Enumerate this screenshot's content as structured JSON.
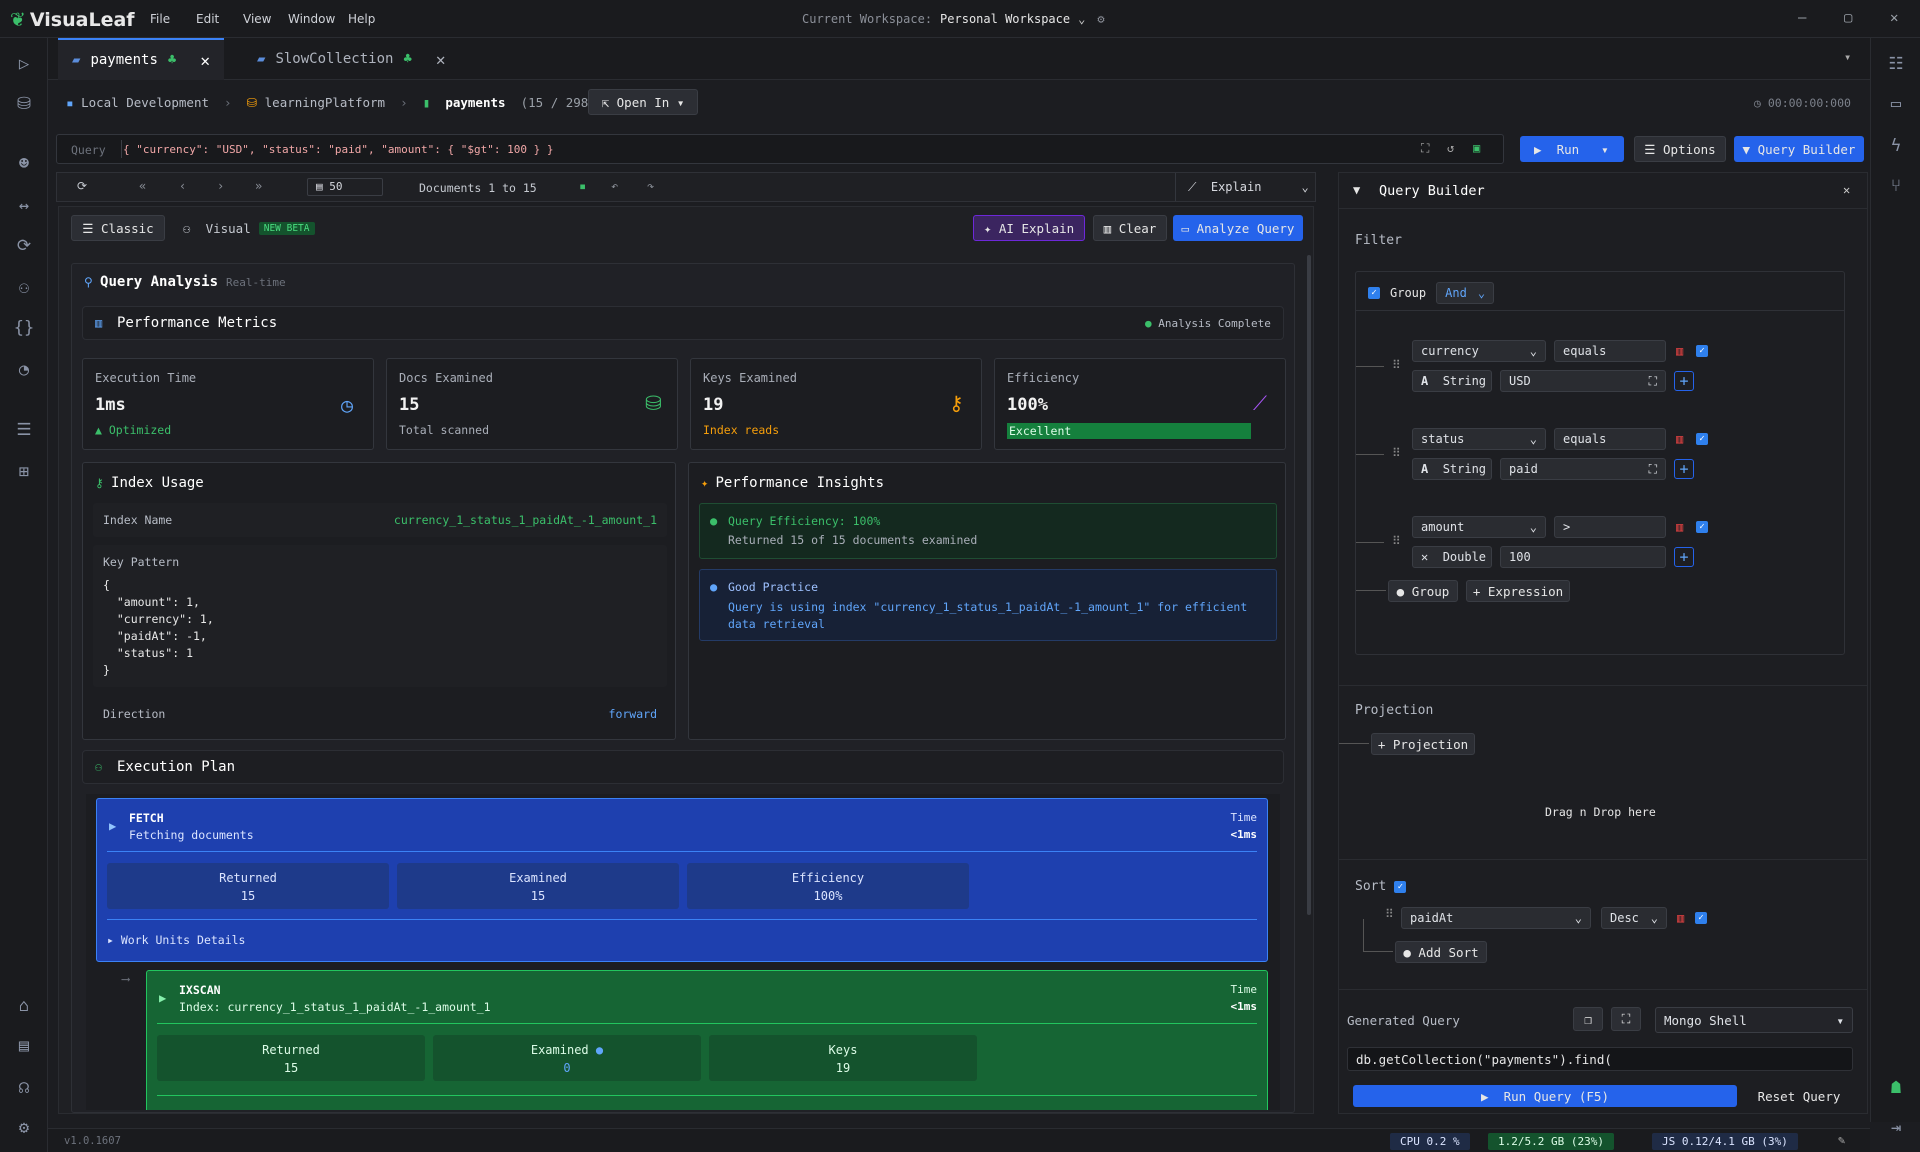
{
  "app": {
    "name": "VisuaLeaf",
    "version": "v1.0.1607"
  },
  "menu": [
    "File",
    "Edit",
    "View",
    "Window",
    "Help"
  ],
  "workspace": {
    "label": "Current Workspace:",
    "value": "Personal Workspace"
  },
  "tabs": [
    {
      "label": "payments",
      "active": true
    },
    {
      "label": "SlowCollection",
      "active": false
    }
  ],
  "breadcrumb": {
    "connection": "Local Development",
    "database": "learningPlatform",
    "collection": "payments",
    "count": "(15 / 298)",
    "open_in": "Open In",
    "timer": "00:00:00:000"
  },
  "query": {
    "label": "Query",
    "value": "{ \"currency\": \"USD\", \"status\": \"paid\", \"amount\": { \"$gt\": 100 } }",
    "run": "Run",
    "options": "Options",
    "query_builder": "Query Builder"
  },
  "toolbar": {
    "page_size": "50",
    "docs_range": "Documents 1 to 15",
    "explain": "Explain"
  },
  "analysis": {
    "classic": "Classic",
    "visual": "Visual",
    "new_beta": "NEW BETA",
    "ai_explain": "AI Explain",
    "clear": "Clear",
    "analyze": "Analyze Query",
    "title": "Query Analysis",
    "subtitle": "Real-time",
    "perf_title": "Performance Metrics",
    "complete": "Analysis Complete",
    "metrics": [
      {
        "label": "Execution Time",
        "value": "1ms",
        "sub": "▲ Optimized"
      },
      {
        "label": "Docs Examined",
        "value": "15",
        "sub": "Total scanned"
      },
      {
        "label": "Keys Examined",
        "value": "19",
        "sub": "Index reads"
      },
      {
        "label": "Efficiency",
        "value": "100%",
        "sub": "Excellent",
        "bar": 1.0
      }
    ],
    "index": {
      "title": "Index Usage",
      "name_label": "Index Name",
      "name_value": "currency_1_status_1_paidAt_-1_amount_1",
      "pattern_label": "Key Pattern",
      "pattern_lines": [
        "{",
        "  \"amount\": 1,",
        "  \"currency\": 1,",
        "  \"paidAt\": -1,",
        "  \"status\": 1",
        "}"
      ],
      "direction_label": "Direction",
      "direction_value": "forward"
    },
    "insights": {
      "title": "Performance Insights",
      "items": [
        {
          "title": "Query Efficiency: 100%",
          "text": "Returned 15 of 15 documents examined"
        },
        {
          "title": "Good Practice",
          "text": "Query is using index \"currency_1_status_1_paidAt_-1_amount_1\" for efficient data retrieval"
        }
      ]
    },
    "plan": {
      "title": "Execution Plan",
      "fetch": {
        "name": "FETCH",
        "desc": "Fetching documents",
        "time_label": "Time",
        "time": "<1ms",
        "stats": [
          {
            "label": "Returned",
            "value": "15"
          },
          {
            "label": "Examined",
            "value": "15"
          },
          {
            "label": "Efficiency",
            "value": "100%"
          }
        ],
        "work_units": "Work Units Details"
      },
      "ixscan": {
        "name": "IXSCAN",
        "desc": "Index: currency_1_status_1_paidAt_-1_amount_1",
        "time_label": "Time",
        "time": "<1ms",
        "stats": [
          {
            "label": "Returned",
            "value": "15"
          },
          {
            "label": "Examined",
            "value": "0"
          },
          {
            "label": "Keys",
            "value": "19"
          }
        ]
      }
    }
  },
  "builder": {
    "title": "Query Builder",
    "filter": "Filter",
    "group": "Group",
    "logic": "And",
    "conditions": [
      {
        "field": "currency",
        "op": "equals",
        "type": "String",
        "value": "USD"
      },
      {
        "field": "status",
        "op": "equals",
        "type": "String",
        "value": "paid"
      },
      {
        "field": "amount",
        "op": ">",
        "type": "Double",
        "value": "100"
      }
    ],
    "add_group": "Group",
    "add_expression": "Expression",
    "projection": "Projection",
    "add_projection": "Projection",
    "drag": "Drag n Drop here",
    "sort": "Sort",
    "sort_field": "paidAt",
    "sort_dir": "Desc",
    "add_sort": "Add Sort",
    "generated": "Generated Query",
    "shell": "Mongo Shell",
    "code_line": "db.getCollection(\"payments\").find(",
    "run_query": "Run Query (F5)",
    "reset": "Reset Query"
  },
  "status": {
    "cpu": "CPU 0.2 %",
    "mem": "1.2/5.2 GB (23%)",
    "js": "JS 0.12/4.1 GB (3%)"
  },
  "colors": {
    "accent": "#2563eb",
    "success": "#3bbf6a",
    "warning": "#f59e0b",
    "fetch": "#1e40af",
    "ixscan": "#166534"
  }
}
